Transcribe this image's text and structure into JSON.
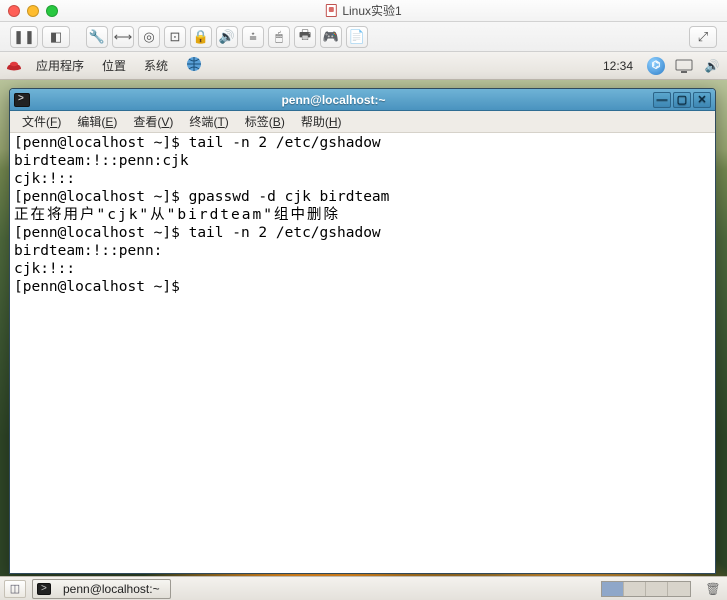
{
  "host": {
    "title": "Linux实验1",
    "toolbar_icons": [
      "pause",
      "stop-record",
      "wrench",
      "fullscreen",
      "drive",
      "hdd",
      "lock",
      "volume",
      "usb",
      "mouse",
      "printer",
      "gamepad",
      "doc"
    ],
    "expand_icon": "expand"
  },
  "gnome": {
    "menu": {
      "apps": "应用程序",
      "places": "位置",
      "system": "系统"
    },
    "clock": "12:34",
    "tray_icons": [
      "bluetooth",
      "network",
      "volume"
    ]
  },
  "terminal": {
    "title": "penn@localhost:~",
    "menubar": [
      {
        "label": "文件",
        "accel": "F"
      },
      {
        "label": "编辑",
        "accel": "E"
      },
      {
        "label": "查看",
        "accel": "V"
      },
      {
        "label": "终端",
        "accel": "T"
      },
      {
        "label": "标签",
        "accel": "B"
      },
      {
        "label": "帮助",
        "accel": "H"
      }
    ],
    "lines": [
      "[penn@localhost ~]$ tail -n 2 /etc/gshadow",
      "birdteam:!::penn:cjk",
      "cjk:!::",
      "[penn@localhost ~]$ gpasswd -d cjk birdteam",
      "正在将用户\"cjk\"从\"birdteam\"组中删除",
      "[penn@localhost ~]$ tail -n 2 /etc/gshadow",
      "birdteam:!::penn:",
      "cjk:!::",
      "[penn@localhost ~]$ "
    ]
  },
  "taskbar": {
    "task_label": "penn@localhost:~",
    "workspaces": 4,
    "active_ws": 0
  }
}
